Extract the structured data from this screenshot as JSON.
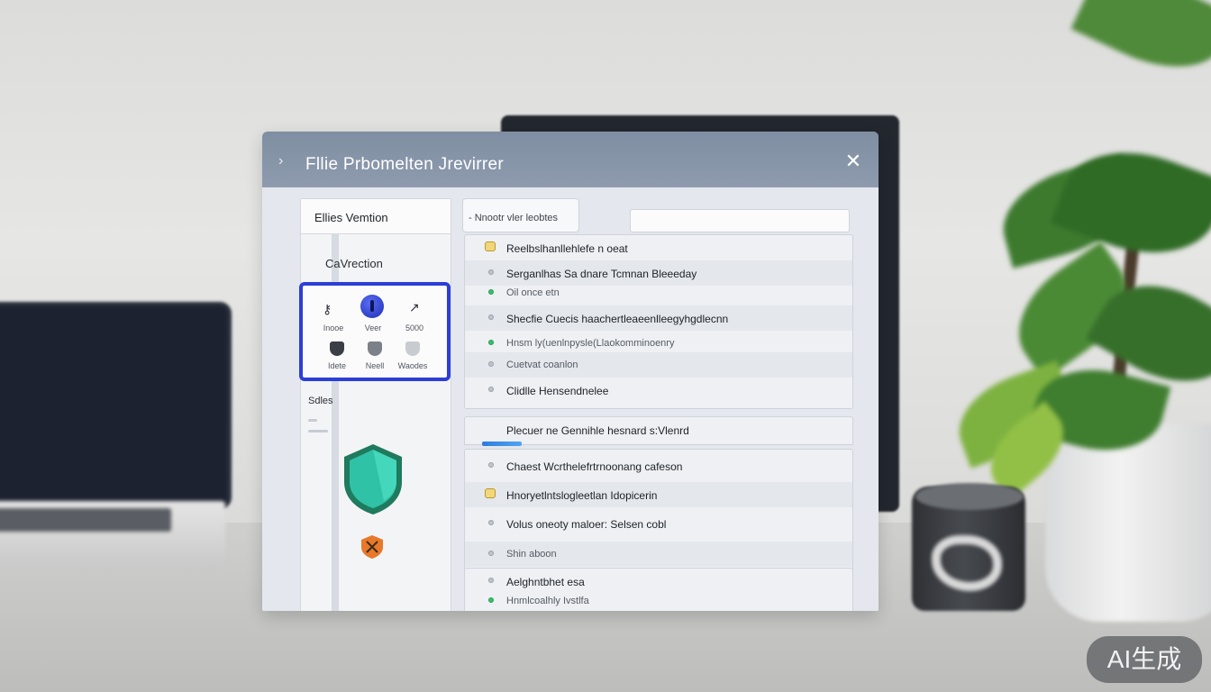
{
  "window": {
    "title": "Fllie Prbomelten Jrevirrer",
    "menu_icon": "chevron-right-icon",
    "close_label": "✕"
  },
  "left_panel": {
    "header": "Ellies Vemtion",
    "subtitle": "CaVrection",
    "icon_labels": [
      "Inooe",
      "Veer",
      "5000",
      "Idete",
      "Neell",
      "Waodes"
    ],
    "status_label": "Sdles"
  },
  "right_panel": {
    "tab_label": "- Nnootr vler leobtes",
    "search": {
      "value": "",
      "placeholder": ""
    },
    "list_top": [
      {
        "text": "Reelbslhanllehlefe n oeat",
        "dot": "yellow"
      },
      {
        "text": "Serganlhas Sa dnare Tcmnan Bleeeday",
        "dot": "gray"
      },
      {
        "text": "Oil once etn",
        "dot": "green"
      },
      {
        "text": "Shecfie Cuecis haachertleaeenlleegyhgdlecnn",
        "dot": "gray"
      },
      {
        "text": "Hnsm ly(uenlnpysle(Llaokomminoenry",
        "dot": "green"
      },
      {
        "text": "Cuetvat coanlon",
        "dot": "gray"
      },
      {
        "text": "Clidlle Hensendnelee",
        "dot": "gray"
      }
    ],
    "list_mid_header": "Plecuer ne Gennihle hesnard s:Vlenrd",
    "list_bottom": [
      {
        "text": "Chaest Wcrthelefrtrnoonang cafeson",
        "dot": "gray"
      },
      {
        "text": "Hnoryetlntslogleetlan Idopicerin",
        "dot": "yellow"
      },
      {
        "text": "Volus oneoty maloer: Selsen cobl",
        "dot": "gray"
      },
      {
        "text": "Shin aboon",
        "dot": "gray"
      }
    ],
    "list_last": [
      {
        "text": "Aelghntbhet esa",
        "dot": "gray"
      },
      {
        "text": "Hnmlcoalhly Ivstlfa",
        "dot": "green"
      }
    ]
  },
  "badge": "AI生成",
  "colors": {
    "titlebar": "#8593a7",
    "accent_blue": "#2c3ed6",
    "shield_teal": "#2fc2a6",
    "shield_orange": "#e8782a"
  }
}
